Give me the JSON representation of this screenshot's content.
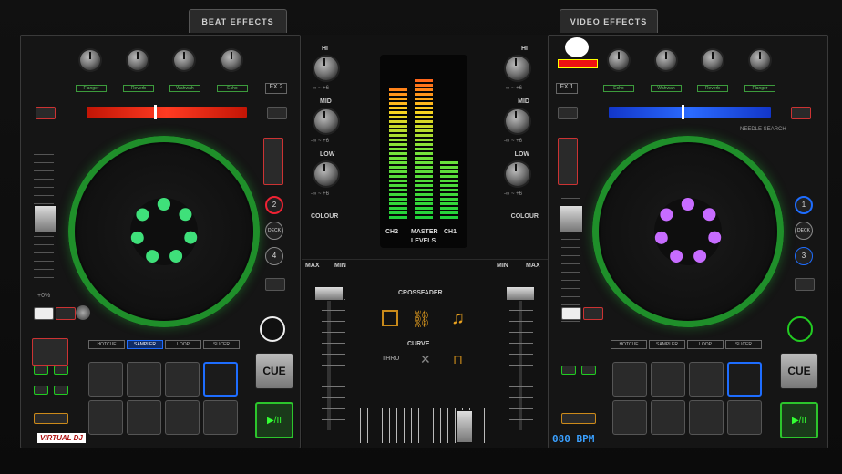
{
  "tabs": {
    "left": "BEAT EFFECTS",
    "right": "VIDEO EFFECTS"
  },
  "deck_left": {
    "fx_label": "FX 2",
    "effect_labels": [
      "Flanger",
      "Reverb",
      "Wahwah",
      "Echo"
    ],
    "tempo_label": "+0%",
    "cue_label": "CUE",
    "play_label": "▶/II",
    "brand": "VIRTUAL DJ",
    "pad_tabs": [
      "HOTCUE",
      "SAMPLER",
      "LOOP",
      "SLICER"
    ],
    "side_buttons": [
      "2",
      "DECK",
      "4"
    ]
  },
  "deck_right": {
    "fx_label": "FX 1",
    "effect_labels": [
      "Echo",
      "Wahwah",
      "Reverb",
      "Flanger"
    ],
    "bpm": "080 BPM",
    "cue_label": "CUE",
    "play_label": "▶/II",
    "pad_tabs": [
      "HOTCUE",
      "SAMPLER",
      "LOOP",
      "SLICER"
    ],
    "side_buttons": [
      "1",
      "DECK",
      "3"
    ],
    "meter_label": "NEEDLE SEARCH"
  },
  "mixer": {
    "eq": [
      "HI",
      "MID",
      "LOW"
    ],
    "scale": "-∞ ~ +6",
    "colour": "COLOUR",
    "levels_labels": [
      "CH1",
      "MASTER",
      "CH2"
    ],
    "levels_title": "LEVELS",
    "max": "MAX",
    "min": "MIN",
    "crossfader": "CROSSFADER",
    "curve": "CURVE",
    "thru": "THRU"
  },
  "levels": {
    "ch1": 0.38,
    "master": 0.9,
    "ch2": 0.85
  },
  "colors": {
    "green": "#2cd33a",
    "red": "#e02010",
    "blue": "#1e5cff",
    "purple": "#c76cff"
  }
}
